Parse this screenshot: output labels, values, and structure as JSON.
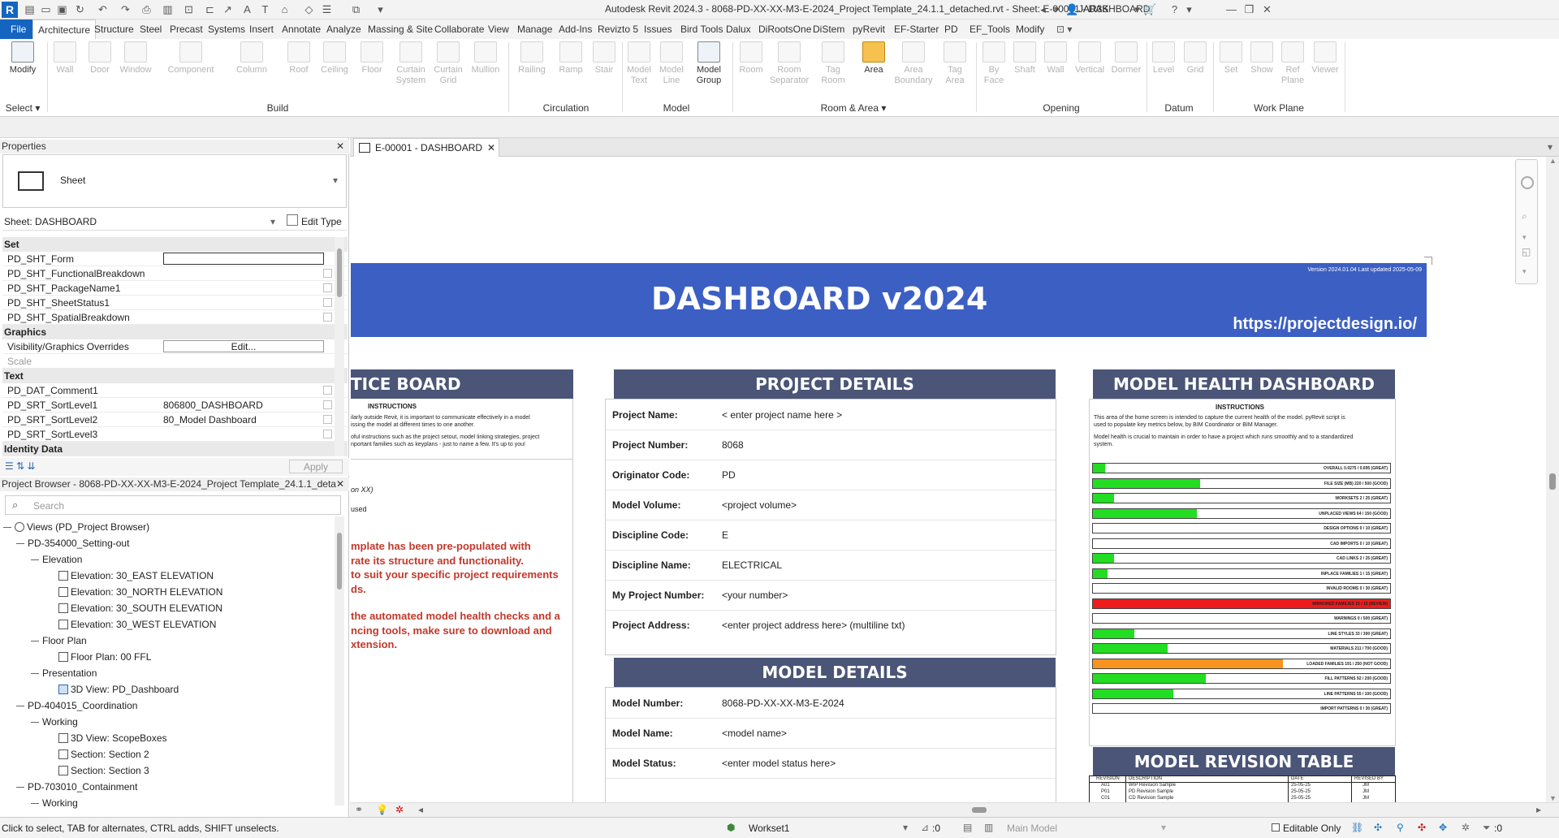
{
  "titlebar": {
    "title": "Autodesk Revit 2024.3 - 8068-PD-XX-XX-M3-E-2024_Project Template_24.1.1_detached.rvt - Sheet: E-00001 - DASHBOARD",
    "user": "JAR3K"
  },
  "menu": {
    "items": [
      "File",
      "Architecture",
      "Structure",
      "Steel",
      "Precast",
      "Systems",
      "Insert",
      "Annotate",
      "Analyze",
      "Massing & Site",
      "Collaborate",
      "View",
      "Manage",
      "Add-Ins",
      "Revizto 5",
      "Issues",
      "Bird Tools",
      "Dalux",
      "DiRootsOne",
      "DiStem",
      "pyRevit",
      "EF-Starter",
      "PD",
      "EF_Tools",
      "Modify"
    ]
  },
  "ribbon": {
    "tools": [
      "Modify",
      "Wall",
      "Door",
      "Window",
      "Component",
      "Column",
      "Roof",
      "Ceiling",
      "Floor",
      "Curtain System",
      "Curtain Grid",
      "Mullion",
      "Railing",
      "Ramp",
      "Stair",
      "Model Text",
      "Model Line",
      "Model Group",
      "Room",
      "Room Separator",
      "Tag Room",
      "Area",
      "Area Boundary",
      "Tag Area",
      "By Face",
      "Shaft",
      "Wall",
      "Vertical",
      "Dormer",
      "Level",
      "Grid",
      "Set",
      "Show",
      "Ref Plane",
      "Viewer"
    ],
    "groups": [
      "Select",
      "Build",
      "Circulation",
      "Model",
      "Room & Area",
      "Opening",
      "Datum",
      "Work Plane"
    ]
  },
  "properties": {
    "title": "Properties",
    "type": "Sheet",
    "selector": "Sheet: DASHBOARD",
    "edit_type": "Edit Type",
    "apply": "Apply",
    "cats": [
      "Set",
      "Graphics",
      "Text",
      "Identity Data"
    ],
    "set": [
      "PD_SHT_Form",
      "PD_SHT_FunctionalBreakdown",
      "PD_SHT_PackageName1",
      "PD_SHT_SheetStatus1",
      "PD_SHT_SpatialBreakdown"
    ],
    "graphics": {
      "k1": "Visibility/Graphics Overrides",
      "v1": "Edit...",
      "k2": "Scale"
    },
    "text": [
      {
        "k": "PD_DAT_Comment1",
        "v": ""
      },
      {
        "k": "PD_SRT_SortLevel1",
        "v": "806800_DASHBOARD"
      },
      {
        "k": "PD_SRT_SortLevel2",
        "v": "80_Model Dashboard"
      },
      {
        "k": "PD_SRT_SortLevel3",
        "v": ""
      }
    ]
  },
  "browser": {
    "title": "Project Browser - 8068-PD-XX-XX-M3-E-2024_Project Template_24.1.1_deta...",
    "search": "Search",
    "items": [
      "Views (PD_Project Browser)",
      "PD-354000_Setting-out",
      "Elevation",
      "Elevation: 30_EAST ELEVATION",
      "Elevation: 30_NORTH ELEVATION",
      "Elevation: 30_SOUTH ELEVATION",
      "Elevation: 30_WEST ELEVATION",
      "Floor Plan",
      "Floor Plan: 00 FFL",
      "Presentation",
      "3D View: PD_Dashboard",
      "PD-404015_Coordination",
      "Working",
      "3D View: ScopeBoxes",
      "Section: Section 2",
      "Section: Section 3",
      "PD-703010_Containment",
      "Working"
    ]
  },
  "view": {
    "tab": "E-00001 - DASHBOARD"
  },
  "dashboard": {
    "title": "DASHBOARD v2024",
    "url": "https://projectdesign.io/",
    "version": "Version 2024.01.04 Last updated 2025-05-09",
    "notice": {
      "title": "TICE BOARD",
      "instr": "INSTRUCTIONS",
      "p1": "ilarly outside Revit, it is important to communicate effectively in a model",
      "p2": "issing the model at different times to one another.",
      "p3": "oful instructions such as the project setout, model linking strategies, project",
      "p4": "nportant families such as keyplans - just to name a few. It's up to you!",
      "n1": "on XX)",
      "n2": "used",
      "r1": "mplate has been pre-populated with",
      "r2": "rate its structure and functionality.",
      "r3": "to suit your specific project requirements",
      "r4": "ds.",
      "r5": "the automated model health checks and a",
      "r6": "ncing tools, make sure to download and",
      "r7": "xtension."
    },
    "project": {
      "title": "PROJECT DETAILS",
      "rows": [
        {
          "k": "Project Name:",
          "v": "< enter project name here >"
        },
        {
          "k": "Project Number:",
          "v": "8068"
        },
        {
          "k": "Originator Code:",
          "v": "PD"
        },
        {
          "k": "Model Volume:",
          "v": "<project volume>"
        },
        {
          "k": "Discipline Code:",
          "v": "E"
        },
        {
          "k": "Discipline Name:",
          "v": "ELECTRICAL"
        },
        {
          "k": "My Project Number:",
          "v": "<your number>"
        },
        {
          "k": "Project Address:",
          "v": "<enter project address here> (multiline txt)"
        }
      ]
    },
    "model": {
      "title": "MODEL DETAILS",
      "rows": [
        {
          "k": "Model Number:",
          "v": "8068-PD-XX-XX-M3-E-2024"
        },
        {
          "k": "Model Name:",
          "v": "<model name>"
        },
        {
          "k": "Model Status:",
          "v": "<enter model status here>"
        }
      ]
    },
    "health": {
      "title": "MODEL HEALTH DASHBOARD",
      "instr": "INSTRUCTIONS",
      "p1": "This area of the home screen is intended to capture the current health of the model. pyRevit script is",
      "p2": "used to populate key metrics below, by BIM Coordinator or BIM Manager.",
      "p3": "Model health is crucial to maintain in order to have a project which runs smoothly and to a standardized",
      "p4": "system.",
      "bars": [
        {
          "label": "OVERALL 0.0275 / 0.695 (GREAT)",
          "fill": 0.04,
          "color": "#22dd22"
        },
        {
          "label": "FILE SIZE (MB) 220 / 500 (GOOD)",
          "fill": 0.36,
          "color": "#22dd22"
        },
        {
          "label": "WORKSETS 2 / 25 (GREAT)",
          "fill": 0.07,
          "color": "#22dd22"
        },
        {
          "label": "UNPLACED VIEWS 64 / 150 (GOOD)",
          "fill": 0.35,
          "color": "#22dd22"
        },
        {
          "label": "DESIGN OPTIONS 0 / 10 (GREAT)",
          "fill": 0,
          "color": "#22dd22"
        },
        {
          "label": "CAD IMPORTS 0 / 10 (GREAT)",
          "fill": 0,
          "color": "#22dd22"
        },
        {
          "label": "CAD LINKS 2 / 25 (GREAT)",
          "fill": 0.07,
          "color": "#22dd22"
        },
        {
          "label": "INPLACE FAMILIES 1 / 15 (GREAT)",
          "fill": 0.05,
          "color": "#22dd22"
        },
        {
          "label": "INVALID ROOMS 0 / 30 (GREAT)",
          "fill": 0,
          "color": "#22dd22"
        },
        {
          "label": "MIRRORED FAMILIES 15 / 15 (REVIEW)",
          "fill": 1.0,
          "color": "#ee1c1c"
        },
        {
          "label": "WARNINGS 0 / 500 (GREAT)",
          "fill": 0,
          "color": "#22dd22"
        },
        {
          "label": "LINE STYLES 33 / 300 (GREAT)",
          "fill": 0.14,
          "color": "#22dd22"
        },
        {
          "label": "MATERIALS 211 / 700 (GOOD)",
          "fill": 0.25,
          "color": "#22dd22"
        },
        {
          "label": "LOADED FAMILIES 191 / 250 (NOT GOOD)",
          "fill": 0.64,
          "color": "#f7931e"
        },
        {
          "label": "FILL PATTERNS 92 / 200 (GOOD)",
          "fill": 0.38,
          "color": "#22dd22"
        },
        {
          "label": "LINE PATTERNS 55 / 100 (GOOD)",
          "fill": 0.27,
          "color": "#22dd22"
        },
        {
          "label": "IMPORT PATTERNS 0 / 30 (GREAT)",
          "fill": 0,
          "color": "#22dd22"
        }
      ]
    },
    "revision": {
      "title": "MODEL REVISION TABLE",
      "headers": [
        "REVISION",
        "DESCRIPTION",
        "DATE",
        "REVISED BY"
      ],
      "rows": [
        [
          "A01",
          "WIP Revision Sample",
          "25-05-25",
          "JM"
        ],
        [
          "P01",
          "PD Revision Sample",
          "25-05-25",
          "JM"
        ],
        [
          "C01",
          "CD Revision Sample",
          "25-05-25",
          "JM"
        ]
      ]
    }
  },
  "status": {
    "hint": "Click to select, TAB for alternates, CTRL adds, SHIFT unselects.",
    "workset": "Workset1",
    "count": ":0",
    "model": "Main Model",
    "editable": "Editable Only",
    "filter": ":0"
  }
}
